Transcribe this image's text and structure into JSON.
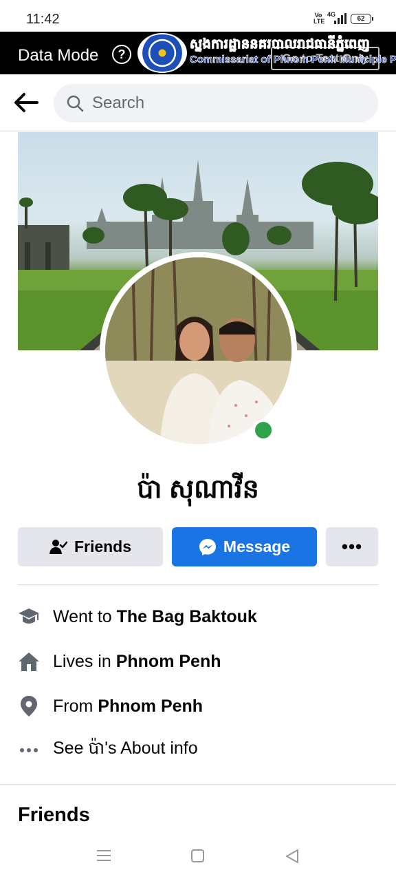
{
  "status_bar": {
    "time": "11:42",
    "volte": "Vo LTE",
    "network": "4G",
    "battery": "62"
  },
  "data_banner": {
    "label": "Data Mode",
    "help_symbol": "?",
    "overlay_khmer": "ស្នងការដ្ឋាននគរបាលរាជធានីភ្នំពេញ",
    "overlay_english": "Commissariat of Phnom Penh Municiple Police",
    "goto_button": "Go to Text Only"
  },
  "header": {
    "search_placeholder": "Search"
  },
  "profile": {
    "name": "ប៉ា សុណាវីន",
    "online": true,
    "accent_color": "#1b74e4",
    "online_color": "#31a24c"
  },
  "actions": {
    "friends_label": "Friends",
    "message_label": "Message",
    "more_label": "•••"
  },
  "intro": {
    "education_prefix": "Went to ",
    "education_value": "The Bag Baktouk",
    "lives_prefix": "Lives in ",
    "lives_value": "Phnom Penh",
    "from_prefix": "From ",
    "from_value": "Phnom Penh",
    "about_label": "See ប៉ា's About info"
  },
  "sections": {
    "friends_heading": "Friends"
  },
  "icons": {
    "back": "arrow-left",
    "search": "magnifier",
    "education": "graduation-cap",
    "home": "house",
    "location": "map-pin",
    "more": "ellipsis"
  }
}
